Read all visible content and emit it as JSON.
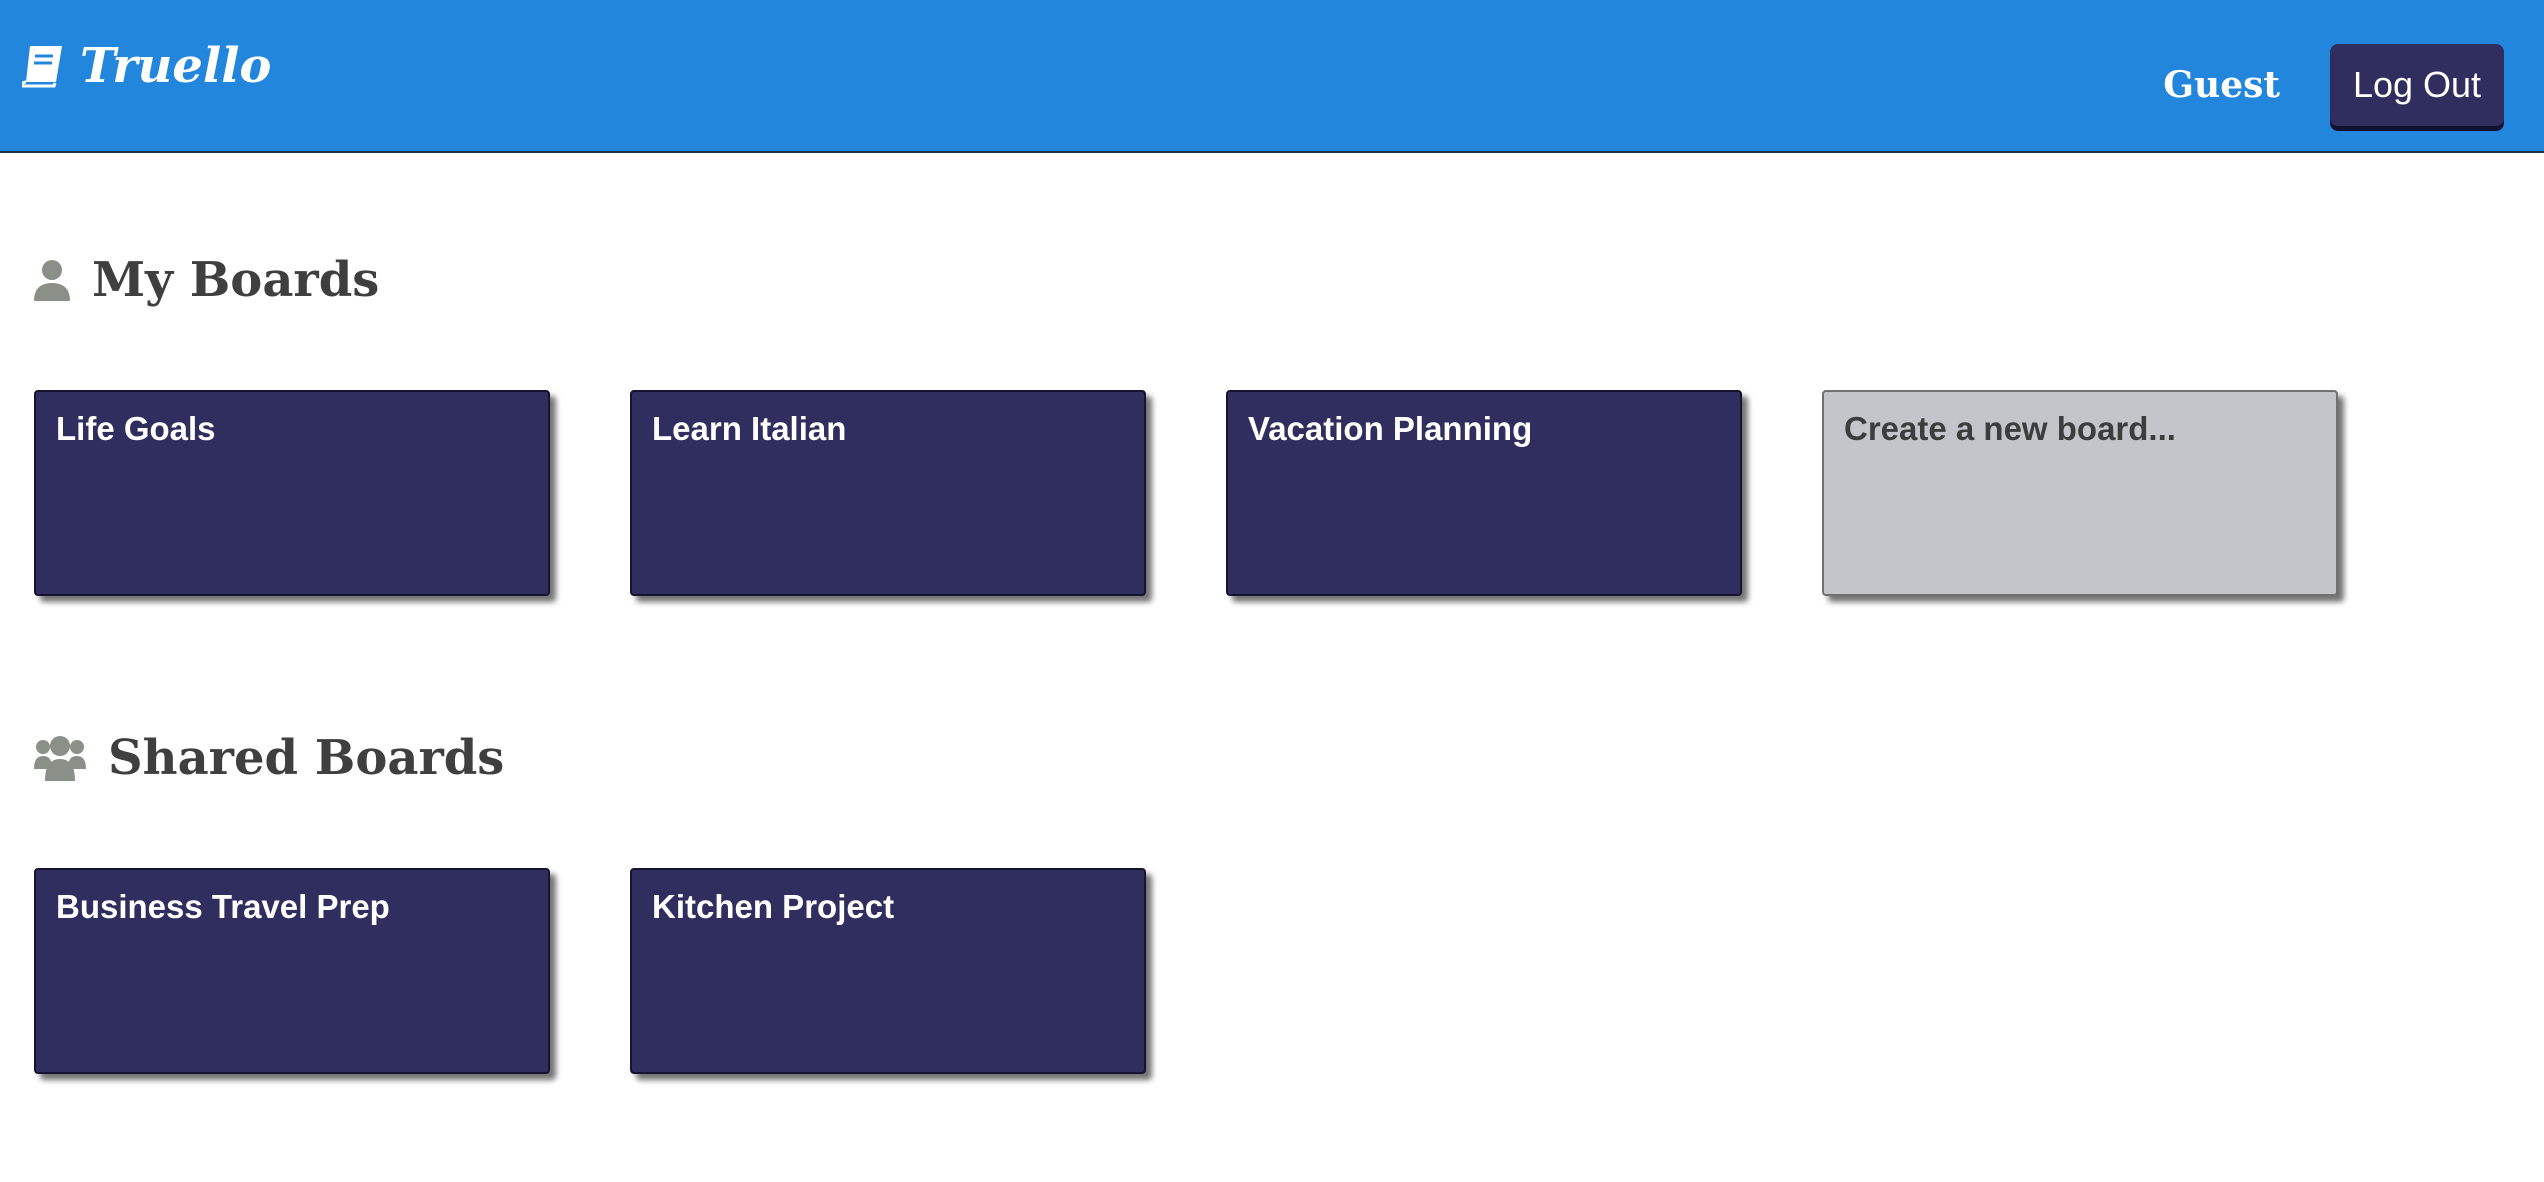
{
  "app": {
    "name": "Truello",
    "icon": "book-icon",
    "colors": {
      "navbar": "#2287dc",
      "board": "#2f2e5e",
      "create_board": "#c3c5cb"
    }
  },
  "header": {
    "username": "Guest",
    "logout_label": "Log Out"
  },
  "my_boards": {
    "title": "My Boards",
    "icon": "user-icon",
    "boards": [
      "Life Goals",
      "Learn Italian",
      "Vacation Planning"
    ],
    "create_label": "Create a new board..."
  },
  "shared_boards": {
    "title": "Shared Boards",
    "icon": "users-icon",
    "boards": [
      "Business Travel Prep",
      "Kitchen Project"
    ]
  }
}
